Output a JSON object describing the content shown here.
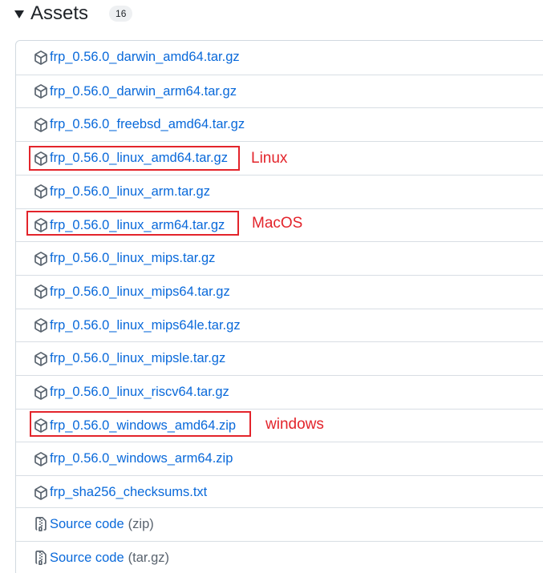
{
  "assets": {
    "title": "Assets",
    "count": "16",
    "rows": [
      {
        "name": "frp_0.56.0_darwin_amd64.tar.gz",
        "icon": "package-icon"
      },
      {
        "name": "frp_0.56.0_darwin_arm64.tar.gz",
        "icon": "package-icon"
      },
      {
        "name": "frp_0.56.0_freebsd_amd64.tar.gz",
        "icon": "package-icon"
      },
      {
        "name": "frp_0.56.0_linux_amd64.tar.gz",
        "icon": "package-icon"
      },
      {
        "name": "frp_0.56.0_linux_arm.tar.gz",
        "icon": "package-icon"
      },
      {
        "name": "frp_0.56.0_linux_arm64.tar.gz",
        "icon": "package-icon"
      },
      {
        "name": "frp_0.56.0_linux_mips.tar.gz",
        "icon": "package-icon"
      },
      {
        "name": "frp_0.56.0_linux_mips64.tar.gz",
        "icon": "package-icon"
      },
      {
        "name": "frp_0.56.0_linux_mips64le.tar.gz",
        "icon": "package-icon"
      },
      {
        "name": "frp_0.56.0_linux_mipsle.tar.gz",
        "icon": "package-icon"
      },
      {
        "name": "frp_0.56.0_linux_riscv64.tar.gz",
        "icon": "package-icon"
      },
      {
        "name": "frp_0.56.0_windows_amd64.zip",
        "icon": "package-icon"
      },
      {
        "name": "frp_0.56.0_windows_arm64.zip",
        "icon": "package-icon"
      },
      {
        "name": "frp_sha256_checksums.txt",
        "icon": "package-icon"
      }
    ],
    "source_rows": [
      {
        "label": "Source code",
        "suffix": "(zip)",
        "icon": "file-zip-icon"
      },
      {
        "label": "Source code",
        "suffix": "(tar.gz)",
        "icon": "file-zip-icon"
      }
    ]
  },
  "annotations": {
    "linux": "Linux",
    "macos": "MacOS",
    "windows": "windows"
  },
  "colors": {
    "link": "#0969da",
    "annotation": "#e3242b",
    "text": "#1f2328",
    "muted": "#59636e"
  }
}
